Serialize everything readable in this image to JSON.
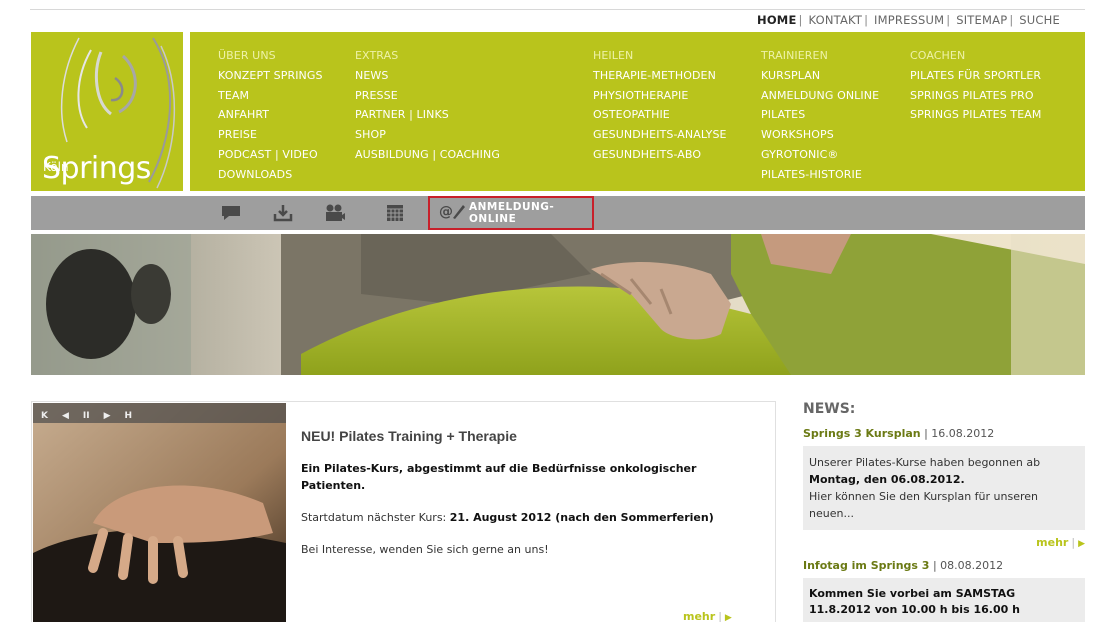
{
  "topnav": {
    "items": [
      "HOME",
      "KONTAKT",
      "IMPRESSUM",
      "SITEMAP",
      "SUCHE"
    ],
    "separator": "|"
  },
  "logo": {
    "brand": "Springs",
    "city": "Köln"
  },
  "nav": {
    "col1": {
      "head": "ÜBER UNS",
      "items": [
        "KONZEPT SPRINGS",
        "TEAM",
        "ANFAHRT",
        "PREISE",
        "PODCAST | VIDEO",
        "DOWNLOADS"
      ]
    },
    "col2": {
      "head": "EXTRAS",
      "items": [
        "NEWS",
        "PRESSE",
        "PARTNER | LINKS",
        "SHOP",
        "AUSBILDUNG | COACHING"
      ]
    },
    "col3": {
      "head": "HEILEN",
      "items": [
        "THERAPIE-METHODEN",
        "PHYSIOTHERAPIE",
        "OSTEOPATHIE",
        "GESUNDHEITS-ANALYSE",
        "GESUNDHEITS-ABO"
      ]
    },
    "col4": {
      "head": "TRAINIEREN",
      "items": [
        "KURSPLAN",
        "ANMELDUNG ONLINE",
        "PILATES",
        "WORKSHOPS",
        "GYROTONIC®",
        "PILATES-HISTORIE"
      ]
    },
    "col5": {
      "head": "COACHEN",
      "items": [
        "PILATES FÜR SPORTLER",
        "SPRINGS PILATES PRO",
        "SPRINGS PILATES TEAM"
      ]
    }
  },
  "iconbar": {
    "icons": [
      "speech-bubble-icon",
      "download-icon",
      "video-camera-icon",
      "calendar-icon",
      "at-pen-icon"
    ],
    "anmeldung_label": "ANMELDUNG-ONLINE"
  },
  "feature": {
    "player_controls": [
      "K",
      "◀",
      "II",
      "▶",
      "H"
    ],
    "title": "NEU! Pilates Training + Therapie",
    "subtitle": "Ein Pilates-Kurs, abgestimmt auf die Bedürfnisse onkologischer Patienten.",
    "start_prefix": "Startdatum nächster Kurs:",
    "start_date": "21. August 2012 (nach den Sommerferien)",
    "interest": "Bei Interesse, wenden Sie sich gerne an uns!",
    "more": "mehr"
  },
  "news": {
    "title": "NEWS:",
    "item1": {
      "headline": "Springs 3 Kursplan",
      "date": "16.08.2012",
      "text1": "Unserer Pilates-Kurse haben begonnen ab",
      "text_bold": "Montag, den 06.08.2012.",
      "text2": "Hier können Sie den Kursplan für unseren neuen...",
      "more": "mehr"
    },
    "item2": {
      "headline": "Infotag im Springs 3",
      "date": "08.08.2012",
      "text": "Kommen Sie vorbei am SAMSTAG 11.8.2012 von 10.00 h bis 16.00 h"
    }
  },
  "colors": {
    "brand_green": "#b9c41c",
    "bar_gray": "#9e9e9e",
    "highlight_red": "#c8202a"
  }
}
